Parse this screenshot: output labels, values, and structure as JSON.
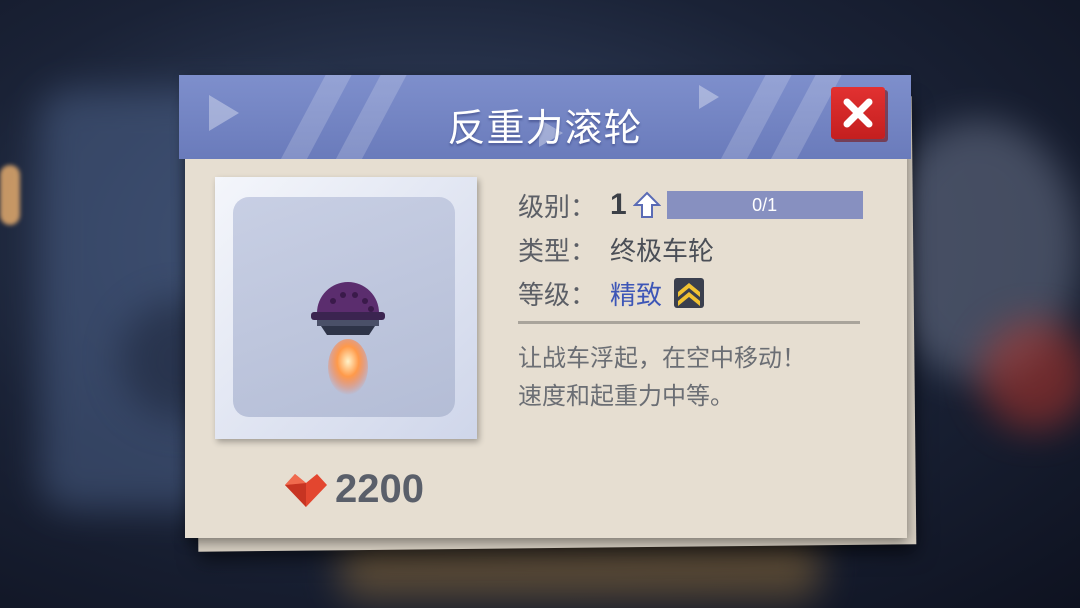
{
  "dialog": {
    "title": "反重力滚轮",
    "close_label": "close"
  },
  "item": {
    "icon": "anti-gravity-wheel-icon",
    "price": "2200",
    "price_icon": "heart-gem-icon"
  },
  "stats": {
    "level_label": "级别：",
    "level_value": "1",
    "level_progress_text": "0/1",
    "level_progress": 0,
    "type_label": "类型：",
    "type_value": "终极车轮",
    "grade_label": "等级：",
    "grade_value": "精致",
    "grade_icon": "chevron-rank-icon"
  },
  "description": {
    "line1": "让战车浮起，在空中移动！",
    "line2": "速度和起重力中等。"
  },
  "colors": {
    "title_bar": "#7383c4",
    "close_button": "#d92a2a",
    "grade_text": "#3d56b7",
    "panel": "#e6ded1"
  }
}
